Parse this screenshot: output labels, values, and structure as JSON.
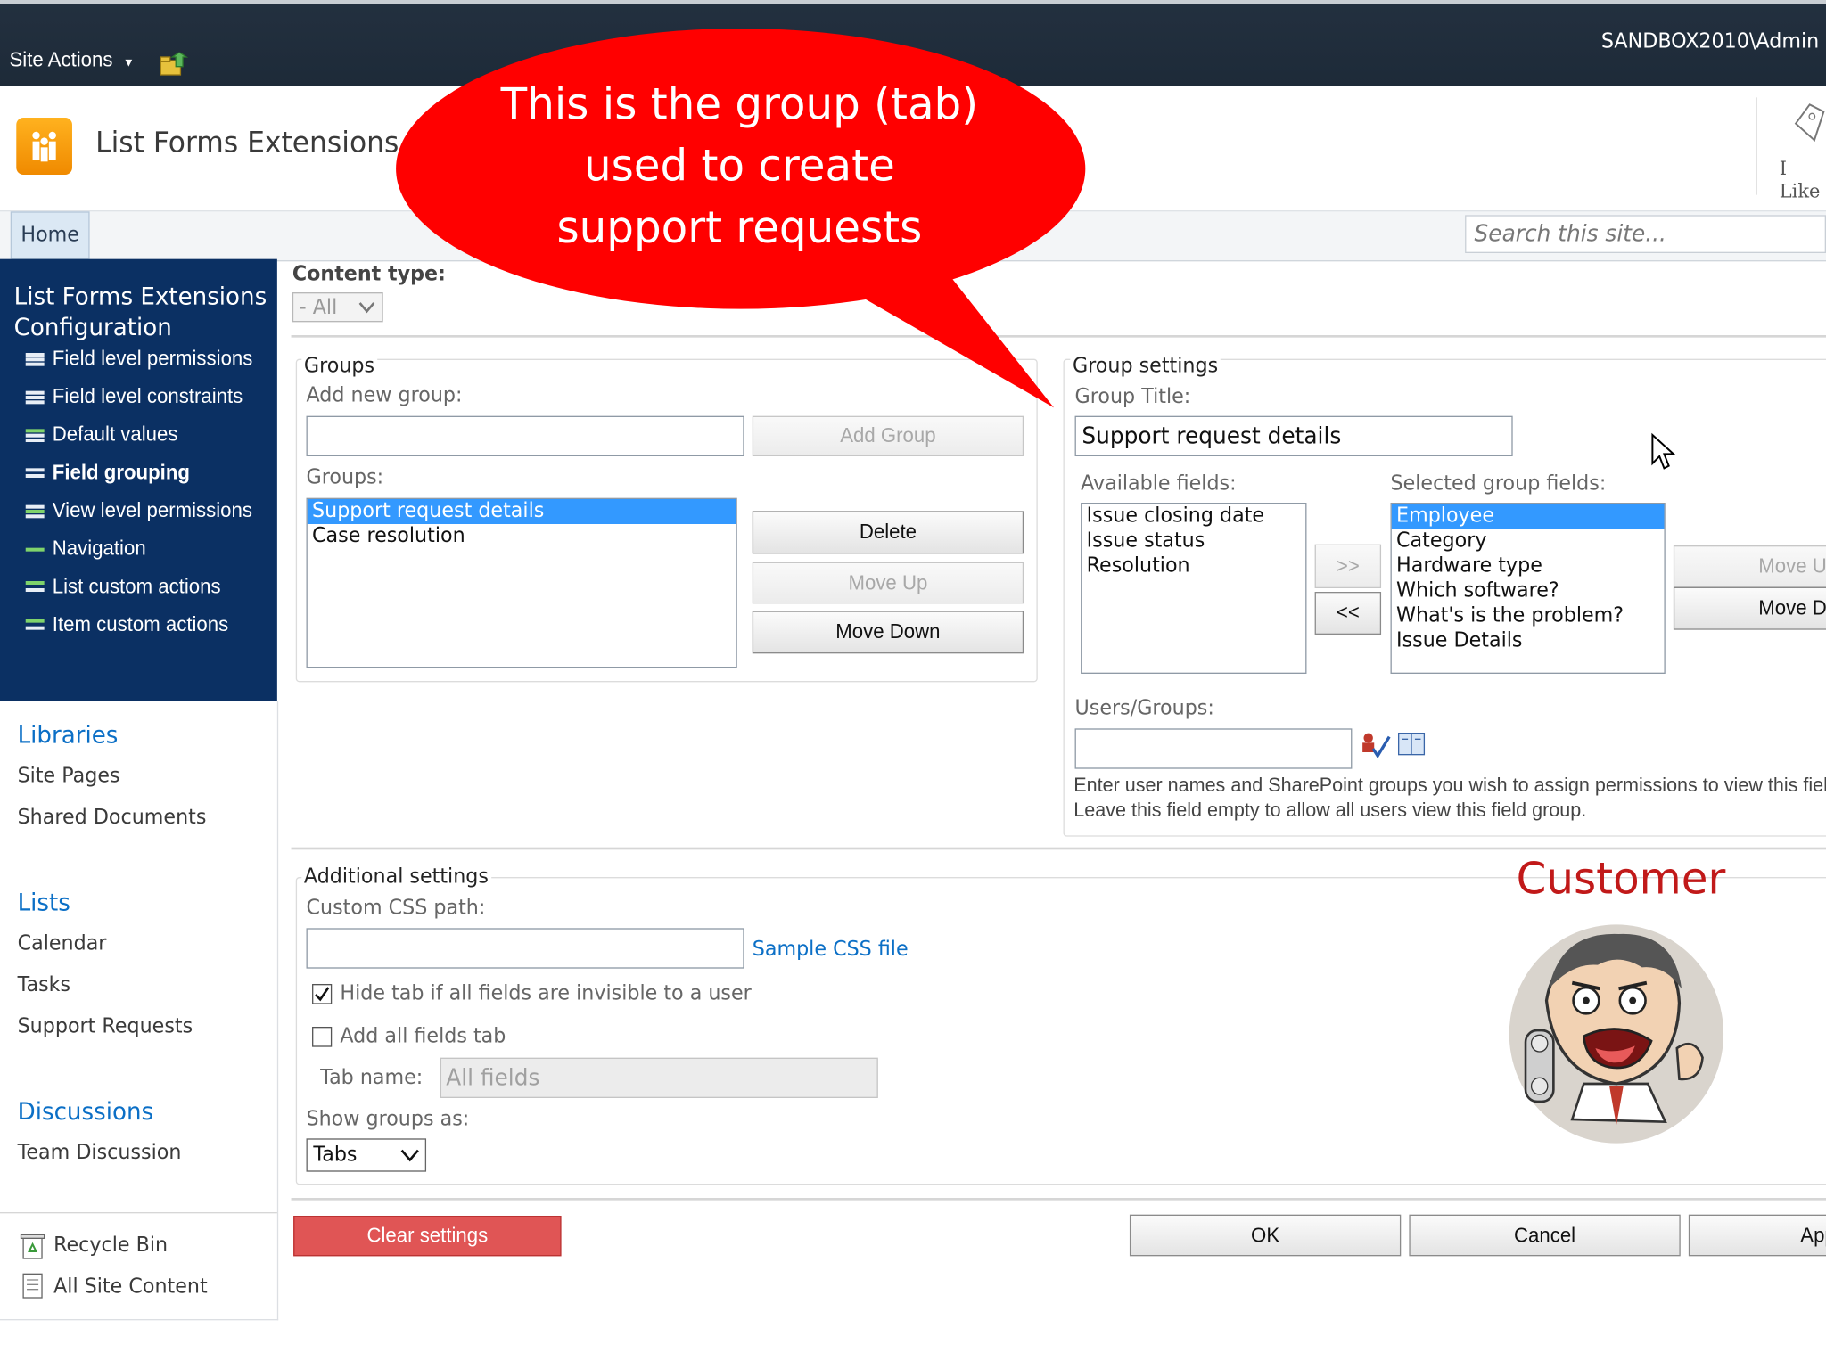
{
  "topbar": {
    "site_actions": "Site Actions",
    "user": "SANDBOX2010\\Admin"
  },
  "header": {
    "site_title": "List Forms Extensions",
    "i_like": "I Like"
  },
  "nav": {
    "home": "Home",
    "search_placeholder": "Search this site..."
  },
  "lfe_menu": {
    "title": "List Forms Extensions Configuration",
    "items": [
      {
        "label": "Field level permissions",
        "bold": false
      },
      {
        "label": "Field level constraints",
        "bold": false
      },
      {
        "label": "Default values",
        "bold": false
      },
      {
        "label": "Field grouping",
        "bold": true
      },
      {
        "label": "View level permissions",
        "bold": false
      },
      {
        "label": "Navigation",
        "bold": false
      },
      {
        "label": "List custom actions",
        "bold": false
      },
      {
        "label": "Item custom actions",
        "bold": false
      }
    ]
  },
  "quicklaunch": {
    "libraries": "Libraries",
    "library_items": [
      "Site Pages",
      "Shared Documents"
    ],
    "lists": "Lists",
    "list_items": [
      "Calendar",
      "Tasks",
      "Support Requests"
    ],
    "discussions": "Discussions",
    "discussion_items": [
      "Team Discussion"
    ],
    "recycle_bin": "Recycle Bin",
    "all_site_content": "All Site Content"
  },
  "form": {
    "content_type_label": "Content type:",
    "content_type_value": "- All",
    "groups": {
      "legend": "Groups",
      "add_new_label": "Add new group:",
      "add_button": "Add Group",
      "groups_label": "Groups:",
      "list": [
        "Support request details",
        "Case resolution"
      ],
      "delete_button": "Delete",
      "move_up_button": "Move Up",
      "move_down_button": "Move Down"
    },
    "group_settings": {
      "legend": "Group settings",
      "title_label": "Group Title:",
      "title_value": "Support request details",
      "available_label": "Available fields:",
      "available": [
        "Issue closing date",
        "Issue status",
        "Resolution"
      ],
      "selected_label": "Selected group fields:",
      "selected": [
        "Employee",
        "Category",
        "Hardware type",
        "Which software?",
        "What's is the problem?",
        "Issue Details"
      ],
      "add_arrow": ">>",
      "remove_arrow": "<<",
      "move_up": "Move Up",
      "move_down": "Move Down",
      "users_label": "Users/Groups:",
      "help_line1": "Enter user names and SharePoint groups you wish to assign permissions to view this field group.",
      "help_line2": "Leave this field empty to allow all users view this field group."
    },
    "additional": {
      "legend": "Additional settings",
      "css_label": "Custom CSS path:",
      "css_link": "Sample CSS file",
      "hide_tab_label": "Hide tab if all fields are invisible to a user",
      "hide_tab_checked": true,
      "all_fields_label": "Add all fields tab",
      "all_fields_checked": false,
      "tab_name_label": "Tab name:",
      "tab_name_value": "All fields",
      "show_as_label": "Show groups as:",
      "show_as_value": "Tabs"
    },
    "buttons": {
      "clear": "Clear settings",
      "ok": "OK",
      "cancel": "Cancel",
      "apply": "Apply"
    }
  },
  "annotations": {
    "callout_lines": [
      "This is the group (tab)",
      "used to create",
      "support requests"
    ],
    "customer": "Customer"
  },
  "colors": {
    "callout_red": "#ff0000",
    "nav_dark": "#0b3063",
    "link_blue": "#0b6fc6",
    "clear_button": "#e05555",
    "selection": "#3399ff"
  }
}
